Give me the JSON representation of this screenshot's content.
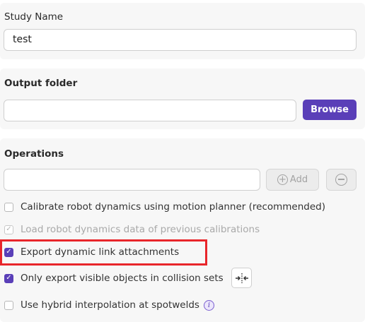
{
  "study": {
    "label": "Study Name",
    "value": "test"
  },
  "output": {
    "label": "Output folder",
    "value": "",
    "browse_label": "Browse"
  },
  "operations": {
    "label": "Operations",
    "value": "",
    "add_label": "Add",
    "options": [
      {
        "label": "Calibrate robot dynamics using motion planner (recommended)",
        "checked": false,
        "disabled": false
      },
      {
        "label": "Load robot dynamics data of previous calibrations",
        "checked": true,
        "disabled": true
      },
      {
        "label": "Export dynamic link attachments",
        "checked": true,
        "disabled": false,
        "highlighted": true
      },
      {
        "label": "Only export visible objects in collision sets",
        "checked": true,
        "disabled": false
      },
      {
        "label": "Use hybrid interpolation at spotwelds",
        "checked": false,
        "disabled": false
      }
    ]
  },
  "colors": {
    "accent": "#5a3fb8",
    "highlight": "#e8262b"
  },
  "icons": {
    "add": "plus-circle-icon",
    "remove": "minus-circle-icon",
    "collision": "collision-select-icon",
    "info": "info-icon",
    "check": "check-icon"
  }
}
